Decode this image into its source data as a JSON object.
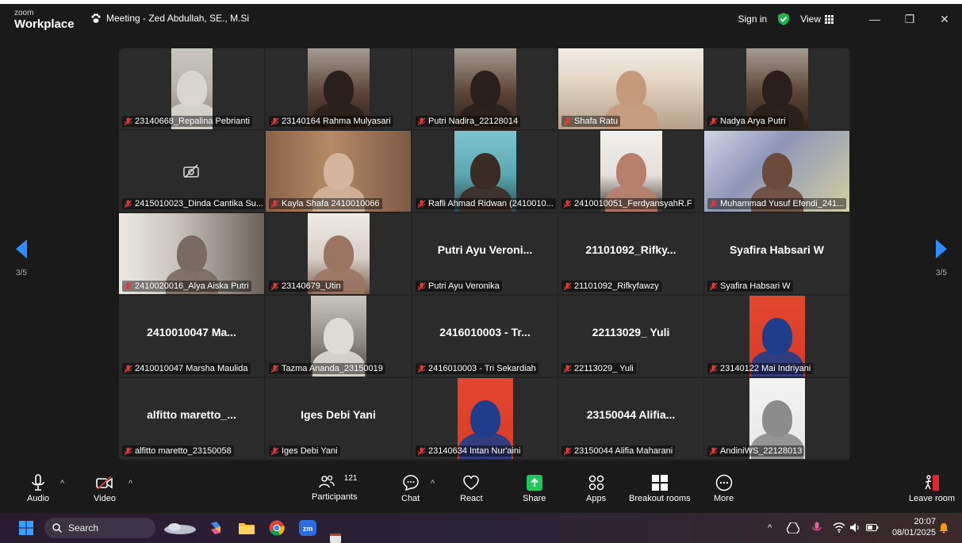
{
  "window": {
    "logo_small": "zoom",
    "logo_big": "Workplace",
    "title": "Meeting - Zed Abdullah, SE., M.Si",
    "signin": "Sign in",
    "view": "View"
  },
  "gallery": {
    "page_left": "3/5",
    "page_right": "3/5",
    "tiles": [
      {
        "label": "23140668_Repalina Pebrianti",
        "display": "",
        "video": "person-hijab-white"
      },
      {
        "label": "23140164 Rahma Mulyasari",
        "display": "",
        "video": "person-dark"
      },
      {
        "label": "Putri Nadira_22128014",
        "display": "",
        "video": "person-dark"
      },
      {
        "label": "Shafa Ratu",
        "display": "",
        "video": "person-room"
      },
      {
        "label": "Nadya Arya Putri",
        "display": "",
        "video": "person-dark"
      },
      {
        "label": "2415010023_Dinda Cantika Su...",
        "display": "",
        "video": "camera-off"
      },
      {
        "label": "Kayla Shafa 2410010066",
        "display": "",
        "video": "person-door"
      },
      {
        "label": "Rafli Ahmad Ridwan (2410010...",
        "display": "",
        "video": "person-window"
      },
      {
        "label": "2410010051_FerdyansyahR.F",
        "display": "",
        "video": "person-wall"
      },
      {
        "label": "Muhammad Yusuf Efendi_241...",
        "display": "",
        "video": "person-bed"
      },
      {
        "label": "2410020016_Alya Aiska Putri",
        "display": "",
        "video": "person-room2"
      },
      {
        "label": "23140679_Utin",
        "display": "",
        "video": "person-light"
      },
      {
        "label": "Putri Ayu Veronika",
        "display": "Putri Ayu Veroni...",
        "video": ""
      },
      {
        "label": "21101092_Rifkyfawzy",
        "display": "21101092_Rifky...",
        "video": ""
      },
      {
        "label": "Syafira Habsari W",
        "display": "Syafira Habsari W",
        "video": ""
      },
      {
        "label": "2410010047 Marsha Maulida",
        "display": "2410010047 Ma...",
        "video": ""
      },
      {
        "label": "Tazma Ananda_23150019",
        "display": "",
        "video": "photo-gray"
      },
      {
        "label": "2416010003 - Tri Sekardiah",
        "display": "2416010003 - Tr...",
        "video": ""
      },
      {
        "label": "22113029_ Yuli",
        "display": "22113029_ Yuli",
        "video": ""
      },
      {
        "label": "23140122 Mai Indriyani",
        "display": "",
        "video": "photo-red"
      },
      {
        "label": "alfitto maretto_23150058",
        "display": "alfitto maretto_...",
        "video": ""
      },
      {
        "label": "Iges Debi Yani",
        "display": "Iges Debi Yani",
        "video": ""
      },
      {
        "label": "23140634 Intan Nur'aini",
        "display": "",
        "video": "photo-red"
      },
      {
        "label": "23150044 Alifia Maharani",
        "display": "23150044 Alifia...",
        "video": ""
      },
      {
        "label": "AndiniWS_22128013",
        "display": "",
        "video": "photo-white"
      }
    ]
  },
  "toolbar": {
    "audio": "Audio",
    "video": "Video",
    "participants": "Participants",
    "participants_count": "121",
    "chat": "Chat",
    "react": "React",
    "share": "Share",
    "apps": "Apps",
    "breakout": "Breakout rooms",
    "more": "More",
    "leave": "Leave room"
  },
  "taskbar": {
    "search": "Search",
    "time": "20:07",
    "date": "08/01/2025"
  },
  "colors": {
    "accent_blue": "#2d8cff",
    "leave_red": "#e02828",
    "share_green": "#1ec95b",
    "mic_muted": "#e03a3a"
  }
}
